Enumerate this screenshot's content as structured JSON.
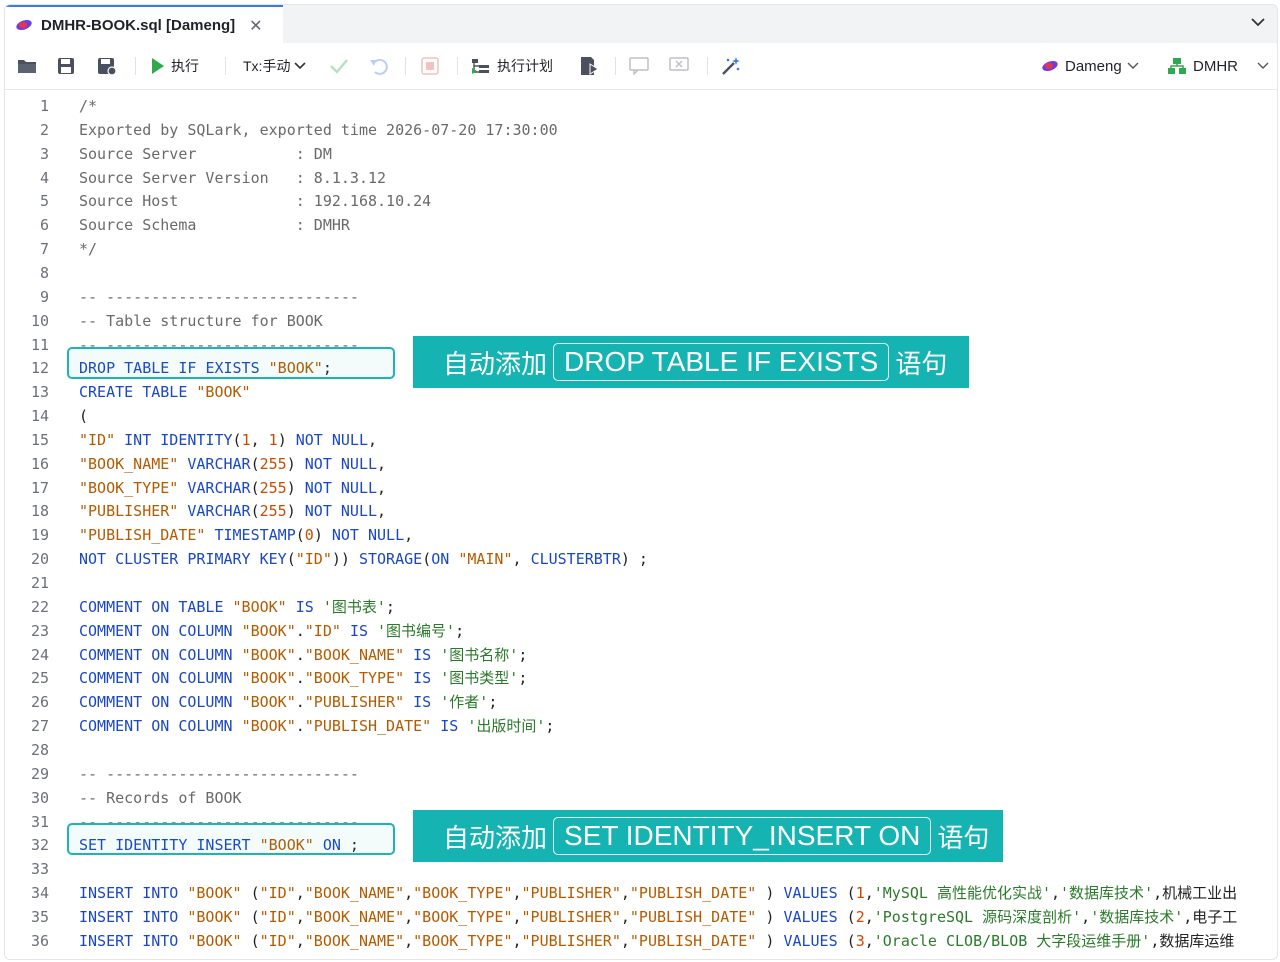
{
  "tab": {
    "title": "DMHR-BOOK.sql [Dameng]",
    "close_glyph": "✕"
  },
  "toolbar": {
    "execute_label": "执行",
    "tx_label": "Tx:手动",
    "plan_label": "执行计划",
    "connection_label": "Dameng",
    "schema_label": "DMHR",
    "accent": "#2fa84f"
  },
  "editor": {
    "lines": [
      "/*",
      "Exported by SQLark, exported time 2026-07-20 17:30:00",
      "Source Server           : DM",
      "Source Server Version   : 8.1.3.12",
      "Source Host             : 192.168.10.24",
      "Source Schema           : DMHR",
      "*/",
      "",
      "-- ----------------------------",
      "-- Table structure for BOOK",
      "-- ----------------------------",
      "DROP TABLE IF EXISTS \"BOOK\";",
      "CREATE TABLE \"BOOK\"",
      "(",
      "\"ID\" INT IDENTITY(1, 1) NOT NULL,",
      "\"BOOK_NAME\" VARCHAR(255) NOT NULL,",
      "\"BOOK_TYPE\" VARCHAR(255) NOT NULL,",
      "\"PUBLISHER\" VARCHAR(255) NOT NULL,",
      "\"PUBLISH_DATE\" TIMESTAMP(0) NOT NULL,",
      "NOT CLUSTER PRIMARY KEY(\"ID\")) STORAGE(ON \"MAIN\", CLUSTERBTR) ;",
      "",
      "COMMENT ON TABLE \"BOOK\" IS '图书表';",
      "COMMENT ON COLUMN \"BOOK\".\"ID\" IS '图书编号';",
      "COMMENT ON COLUMN \"BOOK\".\"BOOK_NAME\" IS '图书名称';",
      "COMMENT ON COLUMN \"BOOK\".\"BOOK_TYPE\" IS '图书类型';",
      "COMMENT ON COLUMN \"BOOK\".\"PUBLISHER\" IS '作者';",
      "COMMENT ON COLUMN \"BOOK\".\"PUBLISH_DATE\" IS '出版时间';",
      "",
      "-- ----------------------------",
      "-- Records of BOOK",
      "-- ----------------------------",
      "SET IDENTITY_INSERT \"BOOK\" ON ;",
      "",
      "INSERT INTO \"BOOK\" (\"ID\",\"BOOK_NAME\",\"BOOK_TYPE\",\"PUBLISHER\",\"PUBLISH_DATE\" ) VALUES (1,'MySQL 高性能优化实战','数据库技术','机械工业出",
      "INSERT INTO \"BOOK\" (\"ID\",\"BOOK_NAME\",\"BOOK_TYPE\",\"PUBLISHER\",\"PUBLISH_DATE\" ) VALUES (2,'PostgreSQL 源码深度剖析','数据库技术','电子工",
      "INSERT INTO \"BOOK\" (\"ID\",\"BOOK_NAME\",\"BOOK_TYPE\",\"PUBLISHER\",\"PUBLISH_DATE\" ) VALUES (3,'Oracle CLOB/BLOB 大字段运维手册','数据库运维"
    ]
  },
  "callouts": [
    {
      "prefix": "自动添加",
      "keyword": "DROP TABLE IF EXISTS",
      "suffix": "语句"
    },
    {
      "prefix": "自动添加",
      "keyword": "SET IDENTITY_INSERT ON",
      "suffix": "语句"
    }
  ],
  "colors": {
    "callout_bg": "#16b3b3",
    "keyword": "#1a47c4",
    "identifier": "#b35b00",
    "string": "#2b7a2b"
  }
}
